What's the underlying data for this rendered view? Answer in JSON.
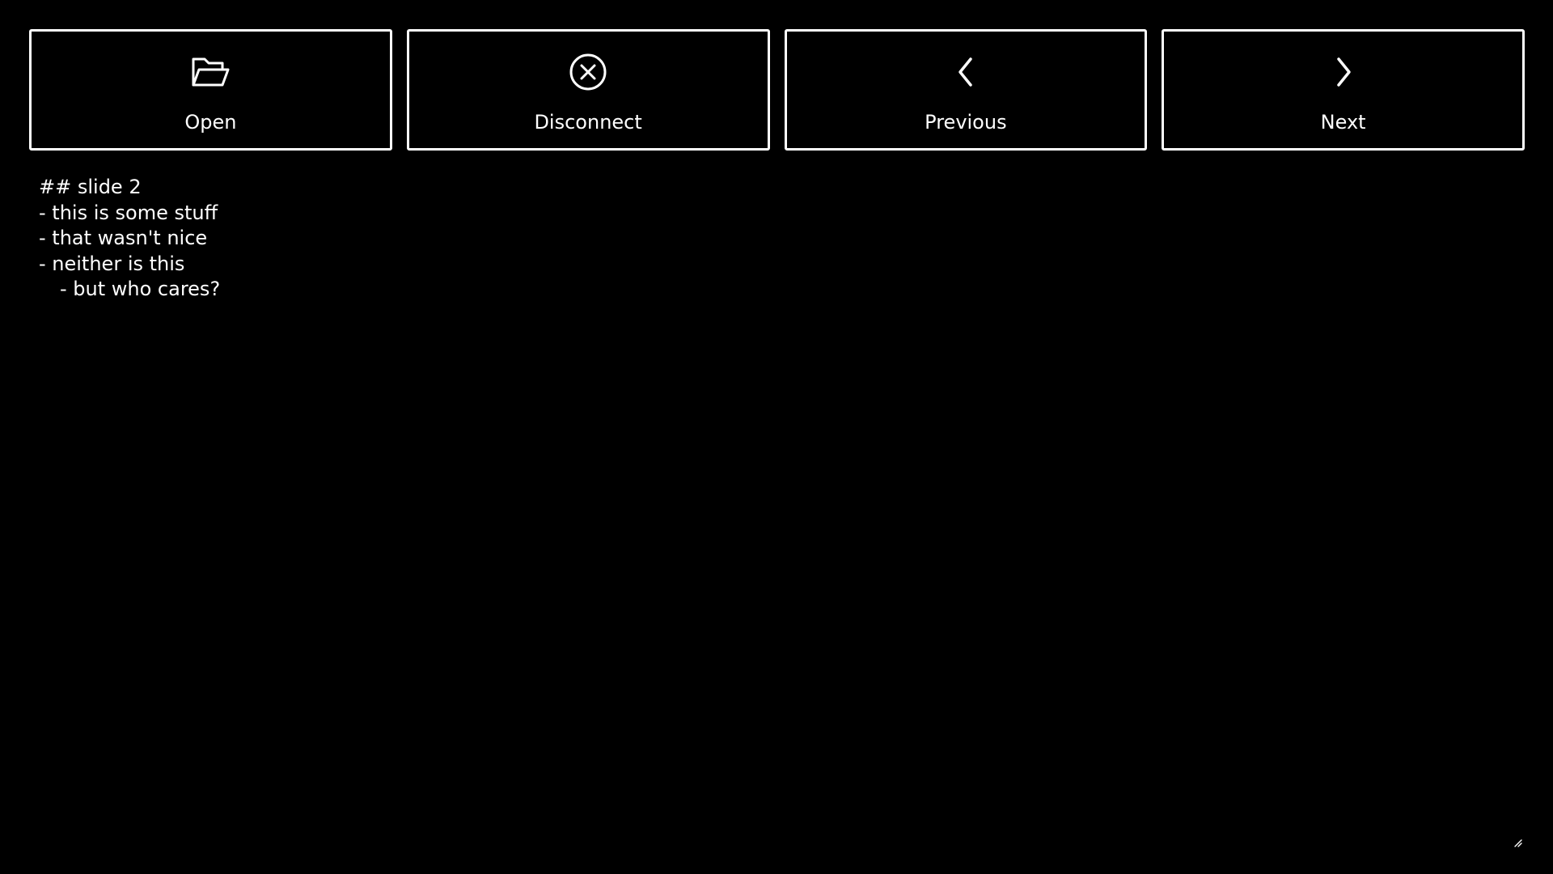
{
  "toolbar": {
    "buttons": [
      {
        "label": "Open",
        "icon": "folder-open-icon"
      },
      {
        "label": "Disconnect",
        "icon": "circle-x-icon"
      },
      {
        "label": "Previous",
        "icon": "chevron-left-icon"
      },
      {
        "label": "Next",
        "icon": "chevron-right-icon"
      }
    ]
  },
  "slide": {
    "lines": [
      "## slide 2",
      "- this is some stuff",
      "- that wasn't nice",
      "- neither is this",
      "- but who cares?"
    ]
  },
  "colors": {
    "background": "#000000",
    "foreground": "#ffffff"
  }
}
